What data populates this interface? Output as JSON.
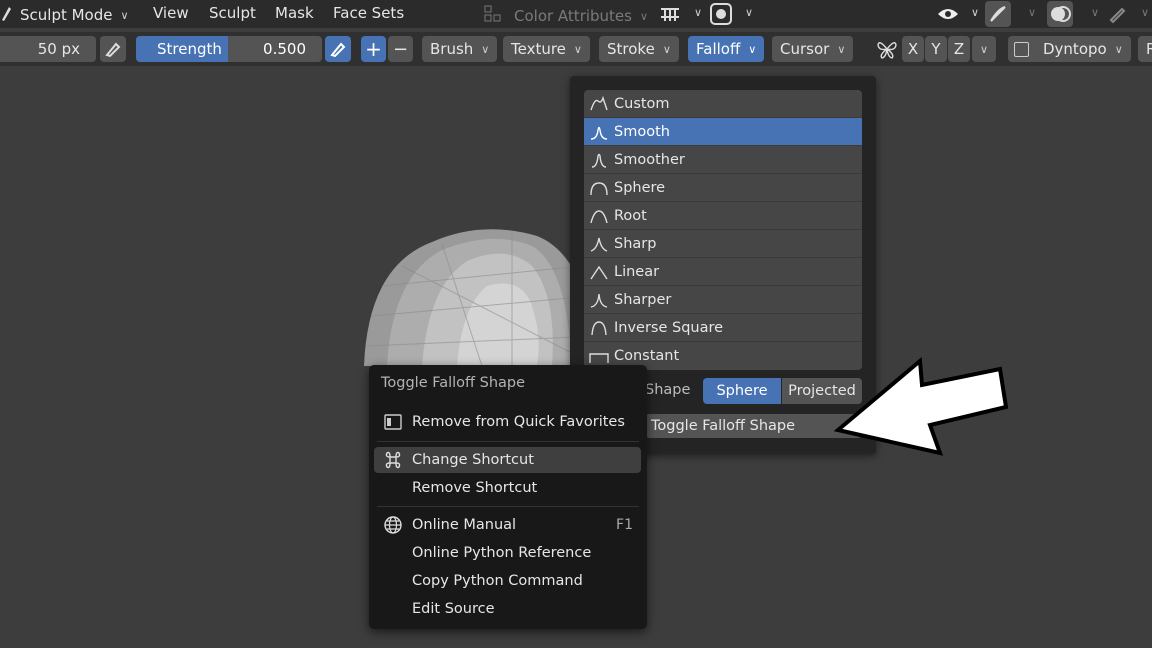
{
  "header": {
    "mode": "Sculpt Mode",
    "menus": [
      "View",
      "Sculpt",
      "Mask",
      "Face Sets"
    ],
    "color_attributes": "Color Attributes"
  },
  "toolbar": {
    "radius": "50 px",
    "strength_label": "Strength",
    "strength_value": "0.500",
    "plus": "+",
    "minus": "−",
    "brush": "Brush",
    "texture": "Texture",
    "stroke": "Stroke",
    "falloff": "Falloff",
    "cursor": "Cursor",
    "x": "X",
    "y": "Y",
    "z": "Z",
    "dyntopo": "Dyntopo",
    "cut_letter": "R"
  },
  "falloff": {
    "items": [
      "Custom",
      "Smooth",
      "Smoother",
      "Sphere",
      "Root",
      "Sharp",
      "Linear",
      "Sharper",
      "Inverse Square",
      "Constant"
    ],
    "selected": "Smooth",
    "shape_label": "Shape",
    "shape_options": [
      "Sphere",
      "Projected"
    ],
    "shape_selected": "Sphere",
    "toggle_label": "Toggle Falloff Shape"
  },
  "context_menu": {
    "title": "Toggle Falloff Shape",
    "remove_fav": "Remove from Quick Favorites",
    "change_shortcut": "Change Shortcut",
    "remove_shortcut": "Remove Shortcut",
    "online_manual": "Online Manual",
    "online_manual_key": "F1",
    "python_ref": "Online Python Reference",
    "copy_python": "Copy Python Command",
    "edit_source": "Edit Source"
  },
  "colors": {
    "accent": "#4772b3",
    "panel": "#242424",
    "menu": "#181818"
  }
}
